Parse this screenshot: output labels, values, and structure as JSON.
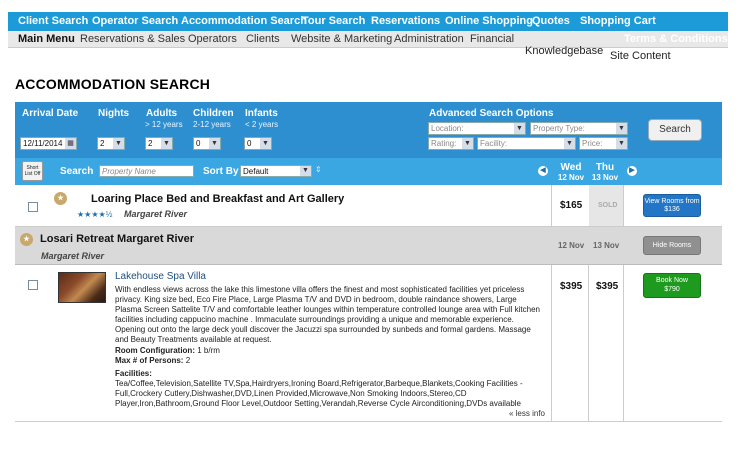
{
  "topnav": {
    "client_search": "Client Search",
    "operator_search": "Operator Search",
    "accommodation_search": "Accommodation Search",
    "tour_search": "Tour Search",
    "reservations": "Reservations",
    "online_shopping": "Online Shopping",
    "quotes": "Quotes",
    "shopping_cart": "Shopping Cart"
  },
  "subnav": {
    "main_menu": "Main Menu",
    "reservations_sales": "Reservations & Sales",
    "operators": "Operators",
    "clients": "Clients",
    "website_marketing": "Website & Marketing",
    "administration": "Administration",
    "financial": "Financial",
    "terms": "Terms & Conditions",
    "knowledgebase": "Knowledgebase",
    "site_content": "Site Content"
  },
  "page": {
    "title": "ACCOMMODATION SEARCH"
  },
  "filters": {
    "arrival_label": "Arrival Date",
    "arrival_value": "12/11/2014",
    "nights_label": "Nights",
    "nights_value": "2",
    "adults_label": "Adults",
    "adults_sub": "> 12 years",
    "adults_value": "2",
    "children_label": "Children",
    "children_sub": "2-12 years",
    "children_value": "0",
    "infants_label": "Infants",
    "infants_sub": "< 2 years",
    "infants_value": "0",
    "advanced_label": "Advanced Search Options",
    "location_placeholder": "Location:",
    "property_type_placeholder": "Property Type:",
    "rating_placeholder": "Rating:",
    "facility_placeholder": "Facility:",
    "price_placeholder": "Price:",
    "search_button": "Search"
  },
  "sortbar": {
    "shortlist_line1": "Short",
    "shortlist_line2": "List Off",
    "search_label": "Search",
    "property_name_placeholder": "Property Name",
    "sort_by_label": "Sort By",
    "sort_value": "Default",
    "day1_name": "Wed",
    "day1_date": "12 Nov",
    "day2_name": "Thu",
    "day2_date": "13 Nov"
  },
  "results": [
    {
      "name": "Loaring Place Bed and Breakfast and Art Gallery",
      "stars": "★★★★½",
      "location": "Margaret River",
      "price_day1": "$165",
      "price_day2": "SOLD",
      "button": "View Rooms from $136"
    },
    {
      "name": "Losari Retreat Margaret River",
      "location": "Margaret River",
      "date1": "12 Nov",
      "date2": "13 Nov",
      "button": "Hide Rooms",
      "room": {
        "name": "Lakehouse Spa Villa",
        "description": "With endless views across the lake this limestone villa offers the finest and most sophisticated facilities yet priceless privacy. King size bed, Eco Fire Place, Large Plasma T/V and DVD in bedroom, double raindance showers, Large Plasma Screen Sattelite T/V and comfortable leather lounges within temperature controlled lounge area with Full kitchen facilities including cappucino machine . Immaculate surroundings providing a unique and memorable experience. Opening out onto the large deck youll discover the Jacuzzi spa surrounded by sunbeds and formal gardens. Massage and Beauty Treatments available at request.",
        "config_label": "Room Configuration:",
        "config_value": "1 b/rm",
        "max_label": "Max # of Persons:",
        "max_value": "2",
        "facilities_label": "Facilities:",
        "facilities": "Tea/Coffee,Television,Satellite TV,Spa,Hairdryers,Ironing Board,Refrigerator,Barbeque,Blankets,Cooking Facilities - Full,Crockery Cutlery,Dishwasher,DVD,Linen Provided,Microwave,Non Smoking Indoors,Stereo,CD Player,Iron,Bathroom,Ground Floor Level,Outdoor Setting,Verandah,Reverse Cycle Airconditioning,DVDs available",
        "less_info": "« less info",
        "price_day1": "$395",
        "price_day2": "$395",
        "book_line1": "Book Now",
        "book_line2": "$790"
      }
    }
  ]
}
